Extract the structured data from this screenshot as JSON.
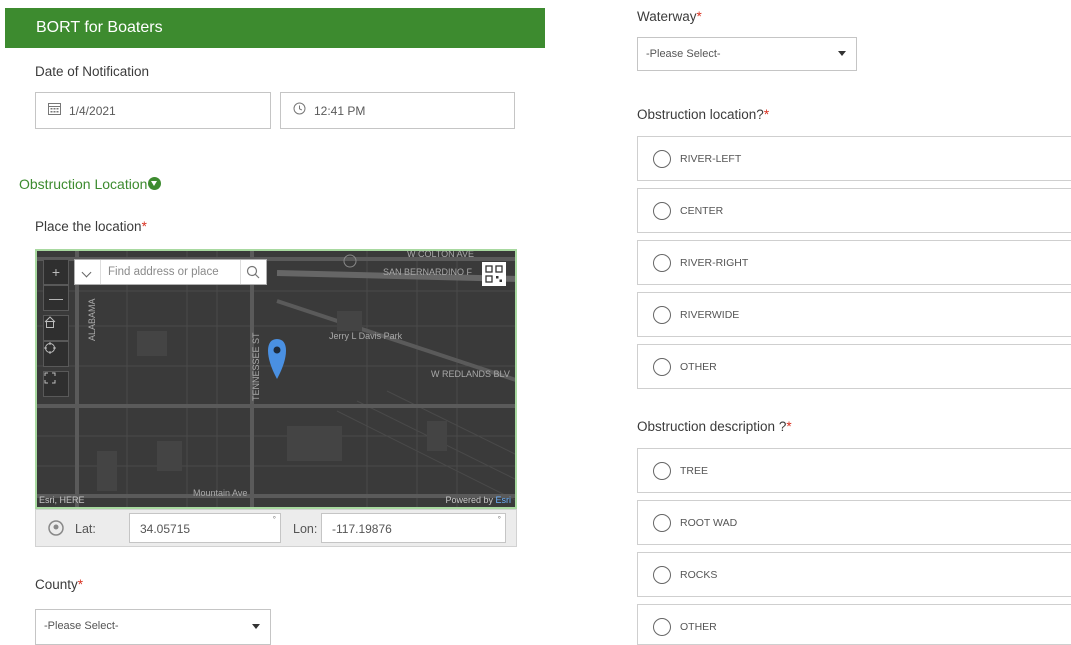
{
  "header": {
    "title": "BORT for Boaters"
  },
  "notification": {
    "label": "Date of Notification",
    "date_value": "1/4/2021",
    "time_value": "12:41 PM"
  },
  "obstruction_section": {
    "title": "Obstruction Location"
  },
  "place_location": {
    "label": "Place the location",
    "required_mark": "*",
    "map": {
      "search_placeholder": "Find address or place",
      "zoom_in": "+",
      "zoom_out": "—",
      "street_labels": [
        "ALABAMA",
        "SAN BERNARDINO F",
        "W COLTON AVE",
        "Jerry L Davis Park",
        "TENNESSEE ST",
        "W REDLANDS BLV",
        "Mountain Ave"
      ],
      "attribution_left": "Esri, HERE",
      "attribution_right_prefix": "Powered by ",
      "attribution_right_brand": "Esri"
    },
    "lat_label": "Lat:",
    "lat_value": "34.05715",
    "lon_label": "Lon:",
    "lon_value": "-117.19876",
    "degree": "°"
  },
  "county": {
    "label": "County",
    "required_mark": "*",
    "selected": "-Please Select-"
  },
  "waterway": {
    "label": "Waterway",
    "required_mark": "*",
    "selected": "-Please Select-"
  },
  "obstruction_location_q": {
    "label": "Obstruction location?",
    "required_mark": "*",
    "options": [
      "RIVER-LEFT",
      "CENTER",
      "RIVER-RIGHT",
      "RIVERWIDE",
      "OTHER"
    ]
  },
  "obstruction_description_q": {
    "label": "Obstruction description ?",
    "required_mark": "*",
    "options": [
      "TREE",
      "ROOT WAD",
      "ROCKS",
      "OTHER"
    ]
  },
  "colors": {
    "brand_green": "#3d8b2f",
    "required_red": "#d83020",
    "pin_blue": "#4a90e2"
  }
}
